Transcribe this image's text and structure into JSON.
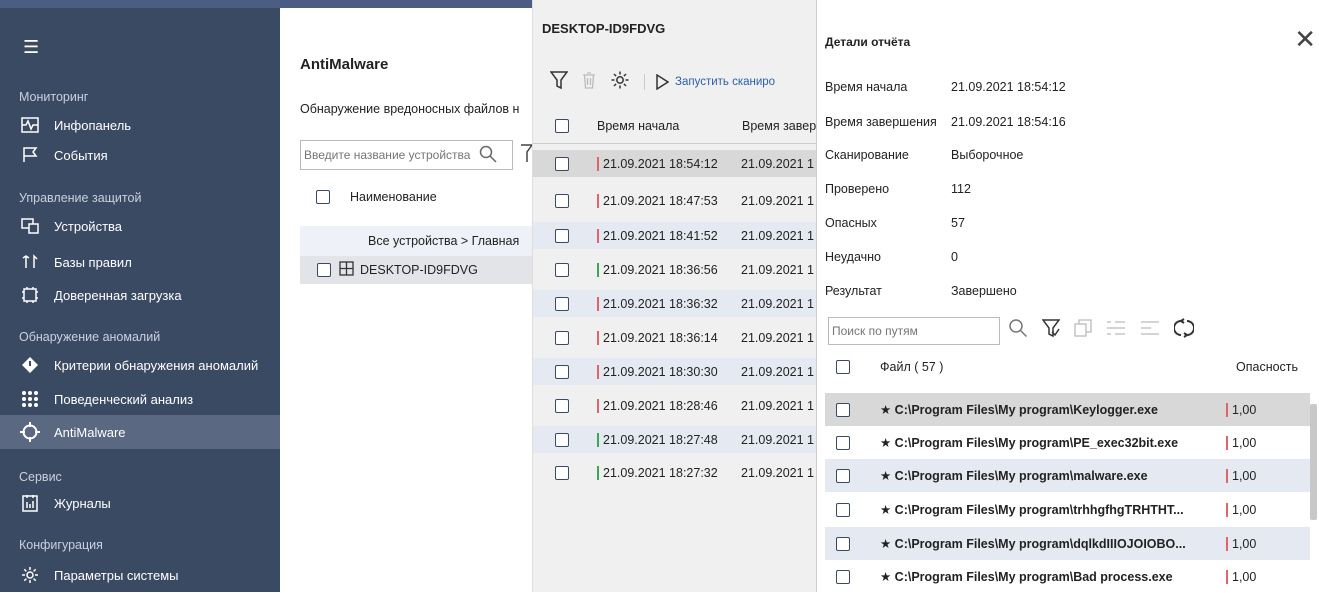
{
  "sidebar": {
    "sections": [
      {
        "label": "Мониторинг"
      },
      {
        "label": "Управление защитой"
      },
      {
        "label": "Обнаружение аномалий"
      },
      {
        "label": "Сервис"
      },
      {
        "label": "Конфигурация"
      }
    ],
    "items": [
      {
        "label": "Инфопанель",
        "icon": "dashboard-icon"
      },
      {
        "label": "События",
        "icon": "flag-icon"
      },
      {
        "label": "Устройства",
        "icon": "devices-icon"
      },
      {
        "label": "Базы правил",
        "icon": "rules-icon"
      },
      {
        "label": "Доверенная загрузка",
        "icon": "trusted-boot-icon"
      },
      {
        "label": "Критерии обнаружения аномалий",
        "icon": "anomaly-criteria-icon"
      },
      {
        "label": "Поведенческий анализ",
        "icon": "behavior-icon"
      },
      {
        "label": "AntiMalware",
        "icon": "crosshair-icon",
        "active": true
      },
      {
        "label": "Журналы",
        "icon": "journal-icon"
      },
      {
        "label": "Параметры системы",
        "icon": "gear-icon"
      }
    ]
  },
  "antimalware": {
    "title": "AntiMalware",
    "description": "Обнаружение вредоносных файлов н",
    "search_placeholder": "Введите название устройства",
    "column_name": "Наименование",
    "breadcrumb": "Все устройства > Главная",
    "device": "DESKTOP-ID9FDVG"
  },
  "scans": {
    "device_title": "DESKTOP-ID9FDVG",
    "run_label": "Запустить сканиро",
    "col_start": "Время начала",
    "col_end": "Время завер",
    "rows": [
      {
        "start": "21.09.2021 18:54:12",
        "end": "21.09.2021 1",
        "status": "red",
        "selected": true
      },
      {
        "start": "21.09.2021 18:47:53",
        "end": "21.09.2021 1",
        "status": "red"
      },
      {
        "start": "21.09.2021 18:41:52",
        "end": "21.09.2021 1",
        "status": "red"
      },
      {
        "start": "21.09.2021 18:36:56",
        "end": "21.09.2021 1",
        "status": "green"
      },
      {
        "start": "21.09.2021 18:36:32",
        "end": "21.09.2021 1",
        "status": "red"
      },
      {
        "start": "21.09.2021 18:36:14",
        "end": "21.09.2021 1",
        "status": "red"
      },
      {
        "start": "21.09.2021 18:30:30",
        "end": "21.09.2021 1",
        "status": "red"
      },
      {
        "start": "21.09.2021 18:28:46",
        "end": "21.09.2021 1",
        "status": "red"
      },
      {
        "start": "21.09.2021 18:27:48",
        "end": "21.09.2021 1",
        "status": "green"
      },
      {
        "start": "21.09.2021 18:27:32",
        "end": "21.09.2021 1",
        "status": "green"
      }
    ]
  },
  "report": {
    "title": "Детали отчёта",
    "fields": [
      {
        "key": "Время начала",
        "value": "21.09.2021 18:54:12"
      },
      {
        "key": "Время завершения",
        "value": "21.09.2021 18:54:16"
      },
      {
        "key": "Сканирование",
        "value": "Выборочное"
      },
      {
        "key": "Проверено",
        "value": "112"
      },
      {
        "key": "Опасных",
        "value": "57"
      },
      {
        "key": "Неудачно",
        "value": "0"
      },
      {
        "key": "Результат",
        "value": "Завершено"
      }
    ],
    "path_search_placeholder": "Поиск по путям",
    "col_file": "Файл ( 57 )",
    "col_danger": "Опасность",
    "files": [
      {
        "path": "★ C:\\Program Files\\My program\\Keylogger.exe",
        "danger": "1,00",
        "selected": true
      },
      {
        "path": "★ C:\\Program Files\\My program\\PE_exec32bit.exe",
        "danger": "1,00"
      },
      {
        "path": "★ C:\\Program Files\\My program\\malware.exe",
        "danger": "1,00"
      },
      {
        "path": "★ C:\\Program Files\\My program\\trhhgfhgTRHTHT...",
        "danger": "1,00"
      },
      {
        "path": "★ C:\\Program Files\\My program\\dqlkdIIIOJOIOBO...",
        "danger": "1,00"
      },
      {
        "path": "★ C:\\Program Files\\My program\\Bad process.exe",
        "danger": "1,00"
      }
    ]
  },
  "colors": {
    "sidebar": "#3b4a63",
    "accent": "#2c5ea8",
    "danger": "#e2646a",
    "ok": "#3aa657",
    "row_alt": "#e4e9f2"
  }
}
